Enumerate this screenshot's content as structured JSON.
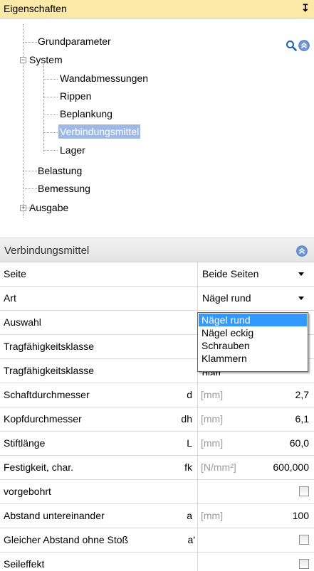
{
  "panel": {
    "title": "Eigenschaften",
    "pin_glyph": "¶"
  },
  "tree": {
    "items": [
      {
        "label": "Grundparameter"
      },
      {
        "label": "System",
        "expander": "−"
      },
      {
        "label": "Wandabmessungen"
      },
      {
        "label": "Rippen"
      },
      {
        "label": "Beplankung"
      },
      {
        "label": "Verbindungsmittel",
        "selected": true
      },
      {
        "label": "Lager"
      },
      {
        "label": "Belastung"
      },
      {
        "label": "Bemessung"
      },
      {
        "label": "Ausgabe",
        "expander": "+"
      }
    ],
    "search_icon": "search-icon",
    "collapse_icon": "collapse-up-icon"
  },
  "section": {
    "title": "Verbindungsmittel",
    "collapse_icon": "collapse-up-icon"
  },
  "grid": {
    "rows": [
      {
        "label": "Seite",
        "value": "Beide Seiten",
        "control": "combo"
      },
      {
        "label": "Art",
        "value": "Nägel rund",
        "control": "combo"
      },
      {
        "label": "Auswahl",
        "value": ""
      },
      {
        "label": "Tragfähigkeitsklasse",
        "value": ""
      },
      {
        "label": "Tragfähigkeitsklasse",
        "value": "glatt"
      },
      {
        "label": "Schaftdurchmesser",
        "symbol": "d",
        "unit": "[mm]",
        "value": "2,7"
      },
      {
        "label": "Kopfdurchmesser",
        "symbol": "dh",
        "unit": "[mm]",
        "value": "6,1"
      },
      {
        "label": "Stiftlänge",
        "symbol": "L",
        "unit": "[mm]",
        "value": "60,0"
      },
      {
        "label": "Festigkeit, char.",
        "symbol": "fk",
        "unit": "[N/mm²]",
        "value": "600,000"
      },
      {
        "label": "vorgebohrt",
        "control": "checkbox",
        "checked": false
      },
      {
        "label": "Abstand untereinander",
        "symbol": "a",
        "unit": "[mm]",
        "value": "100"
      },
      {
        "label": "Gleicher Abstand ohne Stoß",
        "symbol": "a'",
        "control": "checkbox",
        "checked": false
      },
      {
        "label": "Seileffekt",
        "control": "checkbox",
        "checked": false
      }
    ]
  },
  "dropdown": {
    "options": [
      "Nägel rund",
      "Nägel eckig",
      "Schrauben",
      "Klammern"
    ],
    "selected_index": 0
  },
  "colors": {
    "title_bg": "#fbe9a7",
    "selection": "#3399ff",
    "tree_selection": "#9fb8e4"
  }
}
